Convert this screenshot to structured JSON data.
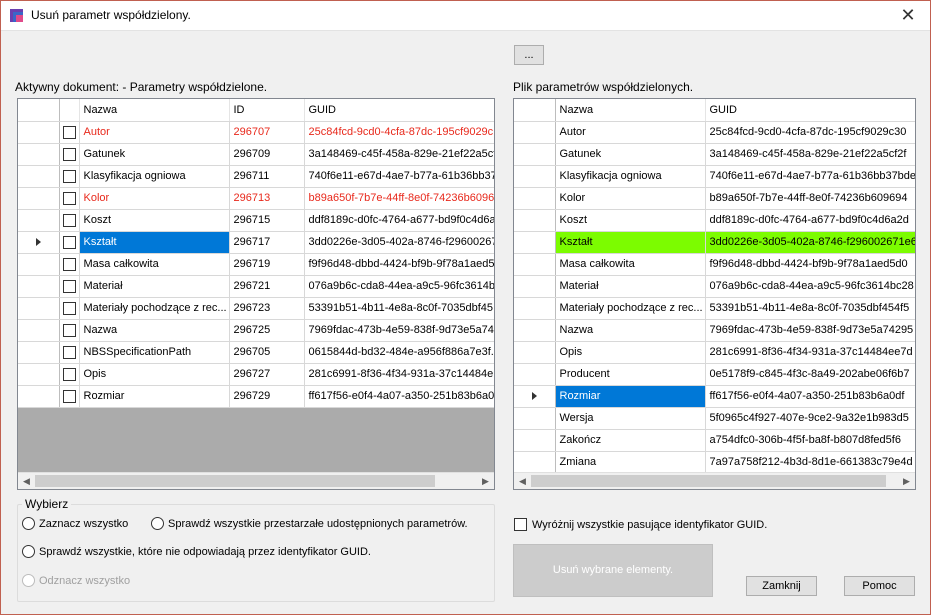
{
  "window": {
    "title": "Usuń parametr współdzielony.",
    "close": "✕"
  },
  "browse_button": "...",
  "left_panel": {
    "label": "Aktywny dokument: - Parametry współdzielone.",
    "columns": [
      "Nazwa",
      "ID",
      "GUID"
    ],
    "rows": [
      {
        "name": "Autor",
        "id": "296707",
        "guid": "25c84fcd-9cd0-4cfa-87dc-195cf9029c...",
        "red": true
      },
      {
        "name": "Gatunek",
        "id": "296709",
        "guid": "3a148469-c45f-458a-829e-21ef22a5cf2"
      },
      {
        "name": "Klasyfikacja ogniowa",
        "id": "296711",
        "guid": "740f6e11-e67d-4ae7-b77a-61b36bb37..."
      },
      {
        "name": "Kolor",
        "id": "296713",
        "guid": "b89a650f-7b7e-44ff-8e0f-74236b60969",
        "red": true
      },
      {
        "name": "Koszt",
        "id": "296715",
        "guid": "ddf8189c-d0fc-4764-a677-bd9f0c4d6a..."
      },
      {
        "name": "Kształt",
        "id": "296717",
        "guid": "3dd0226e-3d05-402a-8746-f29600267...",
        "selected": true
      },
      {
        "name": "Masa całkowita",
        "id": "296719",
        "guid": "f9f96d48-dbbd-4424-bf9b-9f78a1aed5d0"
      },
      {
        "name": "Materiał",
        "id": "296721",
        "guid": "076a9b6c-cda8-44ea-a9c5-96fc3614b..."
      },
      {
        "name": "Materiały pochodzące z rec...",
        "id": "296723",
        "guid": "53391b51-4b11-4e8a-8c0f-7035dbf45..."
      },
      {
        "name": "Nazwa",
        "id": "296725",
        "guid": "7969fdac-473b-4e59-838f-9d73e5a74..."
      },
      {
        "name": "NBSSpecificationPath",
        "id": "296705",
        "guid": "0615844d-bd32-484e-a956f886a7e3f..."
      },
      {
        "name": "Opis",
        "id": "296727",
        "guid": "281c6991-8f36-4f34-931a-37c14484e..."
      },
      {
        "name": "Rozmiar",
        "id": "296729",
        "guid": "ff617f56-e0f4-4a07-a350-251b83b6a0df"
      }
    ]
  },
  "right_panel": {
    "label": "Plik parametrów współdzielonych.",
    "columns": [
      "Nazwa",
      "GUID"
    ],
    "rows": [
      {
        "name": "Autor",
        "guid": "25c84fcd-9cd0-4cfa-87dc-195cf9029c30"
      },
      {
        "name": "Gatunek",
        "guid": "3a148469-c45f-458a-829e-21ef22a5cf2f"
      },
      {
        "name": "Klasyfikacja ogniowa",
        "guid": "740f6e11-e67d-4ae7-b77a-61b36bb37bde"
      },
      {
        "name": "Kolor",
        "guid": "b89a650f-7b7e-44ff-8e0f-74236b609694"
      },
      {
        "name": "Koszt",
        "guid": "ddf8189c-d0fc-4764-a677-bd9f0c4d6a2d"
      },
      {
        "name": "Kształt",
        "guid": "3dd0226e-3d05-402a-8746-f296002671e6",
        "match": true
      },
      {
        "name": "Masa całkowita",
        "guid": "f9f96d48-dbbd-4424-bf9b-9f78a1aed5d0"
      },
      {
        "name": "Materiał",
        "guid": "076a9b6c-cda8-44ea-a9c5-96fc3614bc28"
      },
      {
        "name": "Materiały pochodzące z rec...",
        "guid": "53391b51-4b11-4e8a-8c0f-7035dbf454f5"
      },
      {
        "name": "Nazwa",
        "guid": "7969fdac-473b-4e59-838f-9d73e5a74295"
      },
      {
        "name": "Opis",
        "guid": "281c6991-8f36-4f34-931a-37c14484ee7d"
      },
      {
        "name": "Producent",
        "guid": "0e5178f9-c845-4f3c-8a49-202abe06f6b7"
      },
      {
        "name": "Rozmiar",
        "guid": "ff617f56-e0f4-4a07-a350-251b83b6a0df",
        "selected": true
      },
      {
        "name": "Wersja",
        "guid": "5f0965c4f927-407e-9ce2-9a32e1b983d5"
      },
      {
        "name": "Zakończ",
        "guid": "a754dfc0-306b-4f5f-ba8f-b807d8fed5f6"
      },
      {
        "name": "Zmiana",
        "guid": "7a97a758f212-4b3d-8d1e-661383c79e4d"
      }
    ]
  },
  "select_group": {
    "title": "Wybierz",
    "select_all": "Zaznacz wszystko",
    "check_outdated": "Sprawdź wszystkie przestarzałe udostępnionych parametrów.",
    "check_guid_mismatch": "Sprawdź wszystkie, które nie odpowiadają przez identyfikator GUID.",
    "deselect_all": "Odznacz wszystko"
  },
  "highlight_matching": "Wyróżnij wszystkie pasujące identyfikator GUID.",
  "delete_button": "Usuń wybrane elementy.",
  "close_button": "Zamknij",
  "help_button": "Pomoc",
  "colors": {
    "selection": "#0078d7",
    "match": "#7cfc00",
    "outdated": "#e8291c"
  }
}
